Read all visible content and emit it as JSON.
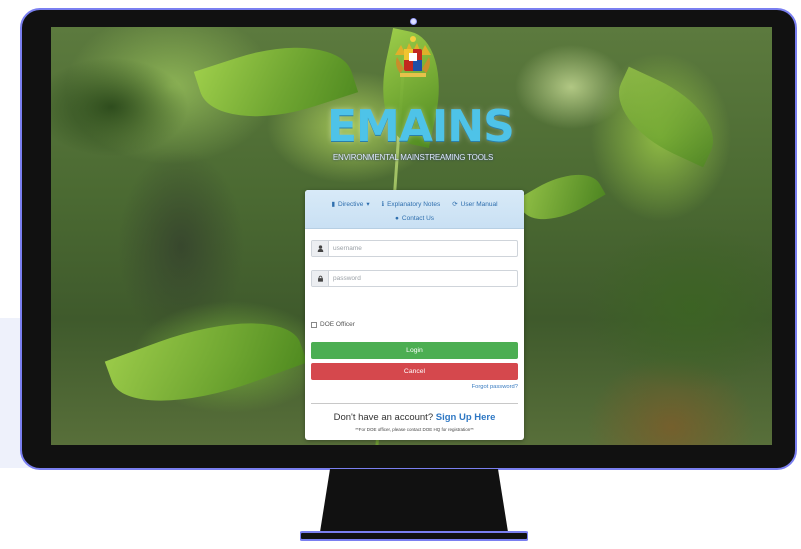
{
  "brand": {
    "title": "EMAINS",
    "tagline": "ENVIRONMENTAL MAINSTREAMING TOOLS"
  },
  "nav": {
    "directive": "Directive",
    "explanatory_notes": "Explanatory Notes",
    "user_manual": "User Manual",
    "contact_us": "Contact Us"
  },
  "form": {
    "username_placeholder": "username",
    "password_placeholder": "password",
    "doe_officer_label": "DOE Officer",
    "login_label": "Login",
    "cancel_label": "Cancel",
    "forgot_password": "Forgot password?"
  },
  "signup": {
    "prompt": "Don't have an account?",
    "link": "Sign Up Here",
    "note": "**For DOE officer, please contact DOE HQ for registration**"
  },
  "colors": {
    "monitor_border": "#7a7ff0",
    "login_button": "#4cae52",
    "cancel_button": "#d5484d",
    "brand_text": "#4ec3e8",
    "link": "#2f78c4"
  },
  "icons": {
    "directive": "bookmark-icon",
    "explanatory_notes": "info-icon",
    "user_manual": "refresh-icon",
    "contact_us": "globe-icon",
    "username": "user-icon",
    "password": "lock-icon"
  }
}
